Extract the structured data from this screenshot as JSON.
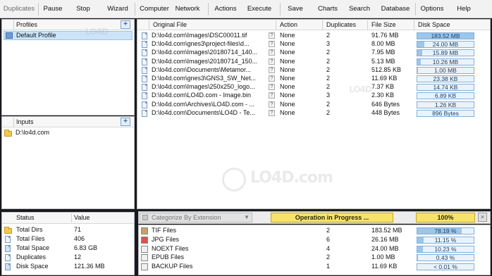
{
  "menu": {
    "items": [
      "Duplicates",
      "Pause",
      "Stop",
      "Wizard",
      "Computer",
      "Network",
      "Actions",
      "Execute",
      "Save",
      "Charts",
      "Search",
      "Database",
      "Options",
      "Help"
    ]
  },
  "profiles": {
    "header": "Profiles",
    "items": [
      "Default Profile"
    ]
  },
  "inputs": {
    "header": "Inputs",
    "items": [
      "D:\\lo4d.com"
    ]
  },
  "status": {
    "columns": [
      "Status",
      "Value"
    ],
    "rows": [
      {
        "label": "Total Dirs",
        "value": "71"
      },
      {
        "label": "Total Files",
        "value": "406"
      },
      {
        "label": "Total Space",
        "value": "6.83 GB"
      },
      {
        "label": "Duplicates",
        "value": "12"
      },
      {
        "label": "Disk Space",
        "value": "121.36 MB"
      }
    ]
  },
  "results": {
    "columns": [
      "Original File",
      "Action",
      "Duplicates",
      "File Size",
      "Disk Space"
    ],
    "rows": [
      {
        "file": "D:\\lo4d.com\\Images\\DSC00011.tif",
        "action": "None",
        "duplicates": "2",
        "size": "91.76 MB",
        "disk": "183.52 MB",
        "fill": 1.0
      },
      {
        "file": "D:\\lo4d.com\\gnes3\\project-files\\d...",
        "action": "None",
        "duplicates": "3",
        "size": "8.00 MB",
        "disk": "24.00 MB",
        "fill": 0.13
      },
      {
        "file": "D:\\lo4d.com\\Images\\20180714_140...",
        "action": "None",
        "duplicates": "2",
        "size": "7.95 MB",
        "disk": "15.89 MB",
        "fill": 0.09
      },
      {
        "file": "D:\\lo4d.com\\Images\\20180714_150...",
        "action": "None",
        "duplicates": "2",
        "size": "5.13 MB",
        "disk": "10.26 MB",
        "fill": 0.06
      },
      {
        "file": "D:\\lo4d.com\\Documents\\Metamor...",
        "action": "None",
        "duplicates": "2",
        "size": "512.85 KB",
        "disk": "1.00 MB",
        "fill": 0.01
      },
      {
        "file": "D:\\lo4d.com\\gnes3\\GNS3_SW_Net...",
        "action": "None",
        "duplicates": "2",
        "size": "11.69 KB",
        "disk": "23.38 KB",
        "fill": 0.0
      },
      {
        "file": "D:\\lo4d.com\\Images\\250x250_logo...",
        "action": "None",
        "duplicates": "2",
        "size": "7.37 KB",
        "disk": "14.74 KB",
        "fill": 0.0
      },
      {
        "file": "D:\\lo4d.com\\LO4D.com - Image.bin",
        "action": "None",
        "duplicates": "3",
        "size": "2.30 KB",
        "disk": "6.89 KB",
        "fill": 0.0
      },
      {
        "file": "D:\\lo4d.com\\Archives\\LO4D.com - ...",
        "action": "None",
        "duplicates": "2",
        "size": "646 Bytes",
        "disk": "1.26 KB",
        "fill": 0.0
      },
      {
        "file": "D:\\lo4d.com\\Documents\\LO4D - Te...",
        "action": "None",
        "duplicates": "2",
        "size": "448 Bytes",
        "disk": "896 Bytes",
        "fill": 0.0
      }
    ]
  },
  "progress": {
    "categorize_label": "Categorize By Extension",
    "operation_label": "Operation in Progress ...",
    "percent_label": "100%",
    "percent": 1.0,
    "close_label": "×"
  },
  "extensions": {
    "rows": [
      {
        "name": "TIF Files",
        "count": "2",
        "size": "183.52 MB",
        "pct": "78.19 %",
        "fill": 0.7819,
        "color": "#c8a06a"
      },
      {
        "name": "JPG Files",
        "count": "6",
        "size": "26.16 MB",
        "pct": "11.15 %",
        "fill": 0.1115,
        "color": "#d9534f"
      },
      {
        "name": "NOEXT Files",
        "count": "4",
        "size": "24.00 MB",
        "pct": "10.23 %",
        "fill": 0.1023,
        "color": "#f0f0f0"
      },
      {
        "name": "EPUB Files",
        "count": "2",
        "size": "1.00 MB",
        "pct": "0.43 %",
        "fill": 0.0043,
        "color": "#f0f0f0"
      },
      {
        "name": "BACKUP Files",
        "count": "1",
        "size": "11.69 KB",
        "pct": "< 0.01 %",
        "fill": 0.0,
        "color": "#f0f0f0"
      }
    ]
  },
  "watermark": {
    "text": "LO4D.com"
  }
}
